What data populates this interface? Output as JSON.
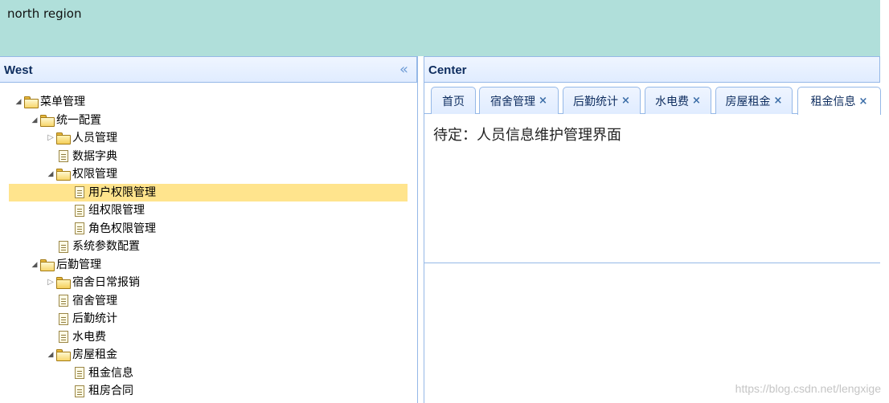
{
  "north": {
    "text": "north region"
  },
  "west": {
    "title": "West",
    "tree": [
      {
        "label": "菜单管理",
        "type": "folder",
        "state": "open",
        "level": 0
      },
      {
        "label": "统一配置",
        "type": "folder",
        "state": "open",
        "level": 1
      },
      {
        "label": "人员管理",
        "type": "folder",
        "state": "closed",
        "level": 2
      },
      {
        "label": "数据字典",
        "type": "file",
        "level": 2
      },
      {
        "label": "权限管理",
        "type": "folder",
        "state": "open",
        "level": 2
      },
      {
        "label": "用户权限管理",
        "type": "file",
        "level": 3,
        "selected": true
      },
      {
        "label": "组权限管理",
        "type": "file",
        "level": 3
      },
      {
        "label": "角色权限管理",
        "type": "file",
        "level": 3
      },
      {
        "label": "系统参数配置",
        "type": "file",
        "level": 2
      },
      {
        "label": "后勤管理",
        "type": "folder",
        "state": "open",
        "level": 1
      },
      {
        "label": "宿舍日常报销",
        "type": "folder",
        "state": "closed",
        "level": 2
      },
      {
        "label": "宿舍管理",
        "type": "file",
        "level": 2
      },
      {
        "label": "后勤统计",
        "type": "file",
        "level": 2
      },
      {
        "label": "水电费",
        "type": "file",
        "level": 2
      },
      {
        "label": "房屋租金",
        "type": "folder",
        "state": "open",
        "level": 2
      },
      {
        "label": "租金信息",
        "type": "file",
        "level": 3
      },
      {
        "label": "租房合同",
        "type": "file",
        "level": 3
      }
    ]
  },
  "center": {
    "title": "Center",
    "tabs": [
      {
        "label": "首页",
        "closable": false
      },
      {
        "label": "宿舍管理",
        "closable": true
      },
      {
        "label": "后勤统计",
        "closable": true
      },
      {
        "label": "水电费",
        "closable": true
      },
      {
        "label": "房屋租金",
        "closable": true
      },
      {
        "label": "租金信息",
        "closable": true
      }
    ],
    "content_text": "待定：人员信息维护管理界面"
  },
  "watermark": "https://blog.csdn.net/lengxige",
  "icons": {
    "collapse": "double-chevron-left-icon",
    "close": "close-icon",
    "folder": "folder-icon",
    "file": "file-icon"
  },
  "colors": {
    "north_bg": "#b0dfda",
    "header_bg": "#e0ecff",
    "border": "#95b8e7",
    "selected": "#ffe48d"
  }
}
